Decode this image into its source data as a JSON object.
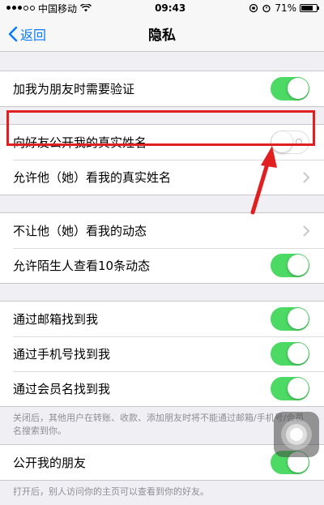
{
  "status_bar": {
    "carrier": "中国移动",
    "time": "09:43",
    "battery": "71%",
    "signal_icon": "signal-dots-icon",
    "wifi_icon": "wifi-icon",
    "battery_level": 0.71
  },
  "nav": {
    "back_label": "返回",
    "title": "隐私"
  },
  "sections": [
    {
      "rows": [
        {
          "label": "加我为朋友时需要验证",
          "control": "toggle",
          "state": "on"
        }
      ]
    },
    {
      "rows": [
        {
          "label": "向好友公开我的真实姓名",
          "control": "toggle",
          "state": "off"
        },
        {
          "label": "允许他（她）看我的真实姓名",
          "control": "chevron"
        }
      ]
    },
    {
      "rows": [
        {
          "label": "不让他（她）看我的动态",
          "control": "chevron"
        },
        {
          "label": "允许陌生人查看10条动态",
          "control": "toggle",
          "state": "on"
        }
      ]
    },
    {
      "rows": [
        {
          "label": "通过邮箱找到我",
          "control": "toggle",
          "state": "on"
        },
        {
          "label": "通过手机号找到我",
          "control": "toggle",
          "state": "on"
        },
        {
          "label": "通过会员名找到我",
          "control": "toggle",
          "state": "on"
        }
      ],
      "footer": "关闭后，其他用户在转账、收款、添加朋友时将不能通过邮箱/手机号/会员名搜索到你。"
    },
    {
      "rows": [
        {
          "label": "公开我的朋友",
          "control": "toggle",
          "state": "on"
        }
      ],
      "footer": "打开后，别人访问你的主页可以查看到你的好友。"
    }
  ],
  "colors": {
    "toggle_on": "#4cd964",
    "accent_blue": "#0a7bff",
    "highlight_red": "#e02020",
    "background": "#efeff4"
  }
}
